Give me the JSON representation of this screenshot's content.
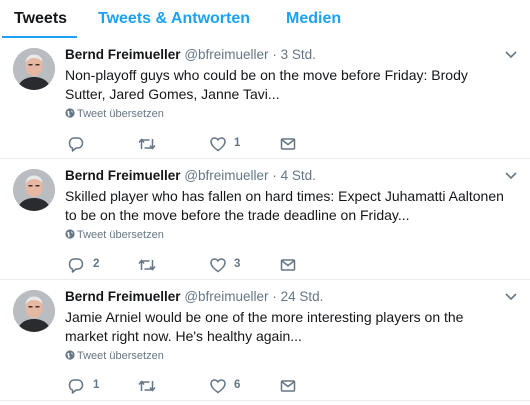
{
  "tabs": [
    {
      "label": "Tweets"
    },
    {
      "label": "Tweets & Antworten"
    },
    {
      "label": "Medien"
    }
  ],
  "tweets": [
    {
      "name": "Bernd Freimueller",
      "handle": "@bfreimueller",
      "separator": "·",
      "time": "3 Std.",
      "text": "Non-playoff guys who could be on the move before Friday: Brody Sutter, Jared Gomes, Janne Tavi...",
      "translate": "Tweet übersetzen",
      "replies": "",
      "retweets": "",
      "likes": "1"
    },
    {
      "name": "Bernd Freimueller",
      "handle": "@bfreimueller",
      "separator": "·",
      "time": "4 Std.",
      "text": "Skilled player who has fallen on hard times: Expect Juhamatti Aaltonen to be on the move before the trade deadline on Friday...",
      "translate": "Tweet übersetzen",
      "replies": "2",
      "retweets": "",
      "likes": "3"
    },
    {
      "name": "Bernd Freimueller",
      "handle": "@bfreimueller",
      "separator": "·",
      "time": "24 Std.",
      "text": "Jamie Arniel would be one of the more interesting players on the market right now. He's healthy again...",
      "translate": "Tweet übersetzen",
      "replies": "1",
      "retweets": "",
      "likes": "6"
    }
  ],
  "colors": {
    "accent": "#1da1f2",
    "text": "#14171a",
    "muted": "#657786",
    "border": "#e6ecf0"
  },
  "icons": {
    "reply": "reply-icon",
    "retweet": "retweet-icon",
    "like": "heart-icon",
    "message": "envelope-icon",
    "more": "chevron-down-icon",
    "translate": "globe-icon"
  }
}
